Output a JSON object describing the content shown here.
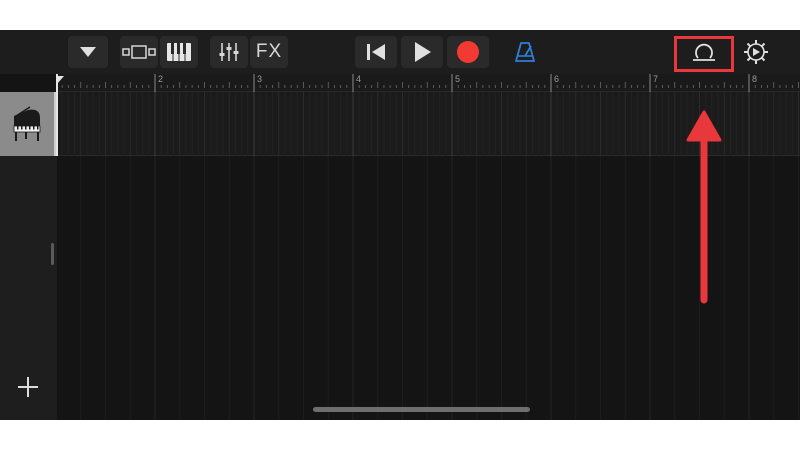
{
  "toolbar": {
    "fx_label": "FX",
    "icons": {
      "dropdown": "triangle-down-icon",
      "tracks_view": "tracks-view-icon",
      "instrument": "keyboard-icon",
      "mixer": "mixer-sliders-icon",
      "rewind": "skip-back-icon",
      "play": "play-icon",
      "record": "record-icon",
      "metronome": "metronome-icon",
      "loop_browser": "loop-icon",
      "settings": "gear-icon"
    }
  },
  "ruler": {
    "bar_numbers": [
      "2",
      "3",
      "4",
      "5",
      "6",
      "7",
      "8"
    ]
  },
  "track": {
    "instrument_icon": "grand-piano-icon"
  },
  "sidebar": {
    "add_icon": "plus-icon"
  },
  "colors": {
    "record": "#f23a32",
    "metronome": "#2f7fd9",
    "annotation": "#e8383b",
    "background": "#141414"
  }
}
